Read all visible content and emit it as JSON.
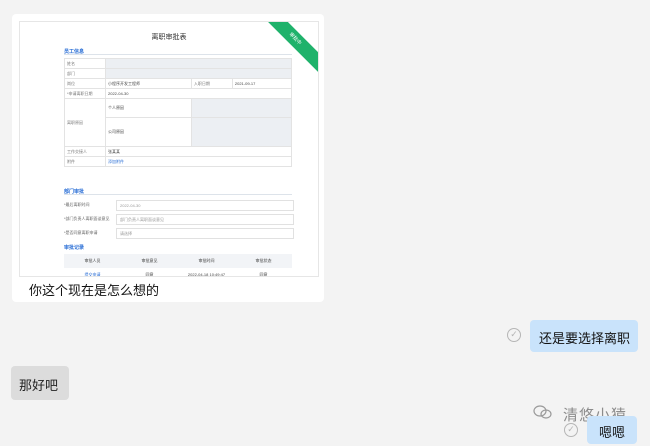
{
  "card": {
    "doc_title": "离职审批表",
    "ribbon": "审批中",
    "section_employee": "员工信息",
    "rows": [
      {
        "k": "姓名",
        "v": "",
        "k2": "",
        "v2": ""
      },
      {
        "k": "部门",
        "v": "",
        "k2": "",
        "v2": ""
      },
      {
        "k": "岗位",
        "v": "小程序开发工程师",
        "k2": "入职日期",
        "v2": "2021-09-17"
      },
      {
        "k": "*申请离职日期",
        "v": "2022-04-30",
        "k2": "",
        "v2": ""
      },
      {
        "k": "",
        "v": "",
        "k2": "",
        "v2": ""
      },
      {
        "k": "",
        "v": "",
        "k2": "",
        "v2": ""
      },
      {
        "k": "工作交接人",
        "v": "张某某",
        "k2": "",
        "v2": ""
      },
      {
        "k": "附件",
        "v": "添加附件",
        "k2": "",
        "v2": ""
      }
    ],
    "personal_reason": "个人原因",
    "company_reason": "公司原因",
    "reason_label": "离职原因",
    "section_dept": "部门审批",
    "form": [
      {
        "label": "*最后离职时间",
        "placeholder": "2022-04-30"
      },
      {
        "label": "*部门负责人离职面谈意见",
        "placeholder": "部门负责人离职面谈意见"
      },
      {
        "label": "*是否同意离职申请",
        "placeholder": "请选择"
      }
    ],
    "section_records": "审批记录",
    "records_head": [
      "审批人员",
      "审批意见",
      "审批时间",
      "审批状态"
    ],
    "records_row": [
      "提交申请",
      "同意",
      "2022-04-18 10:49:47",
      "同意"
    ],
    "caption": "你这个现在是怎么想的"
  },
  "messages": {
    "right_1": "还是要选择离职",
    "left_2": "那好吧",
    "right_3": "嗯嗯"
  },
  "watermark": {
    "brand": "清悠小猿"
  }
}
